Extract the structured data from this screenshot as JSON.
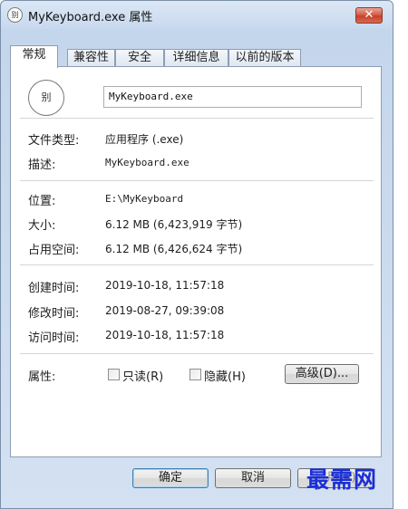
{
  "window": {
    "title": "MyKeyboard.exe 属性",
    "icon_text": "别",
    "close_label": "✕"
  },
  "tabs": [
    {
      "label": "常规",
      "active": true
    },
    {
      "label": "兼容性"
    },
    {
      "label": "安全"
    },
    {
      "label": "详细信息"
    },
    {
      "label": "以前的版本"
    }
  ],
  "general": {
    "file_icon_text": "别",
    "file_name": "MyKeyboard.exe",
    "type_label": "文件类型:",
    "type_value": "应用程序 (.exe)",
    "desc_label": "描述:",
    "desc_value": "MyKeyboard.exe",
    "location_label": "位置:",
    "location_value": "E:\\MyKeyboard",
    "size_label": "大小:",
    "size_value": "6.12 MB (6,423,919 字节)",
    "disk_size_label": "占用空间:",
    "disk_size_value": "6.12 MB (6,426,624 字节)",
    "created_label": "创建时间:",
    "created_value": "2019-10-18, 11:57:18",
    "modified_label": "修改时间:",
    "modified_value": "2019-08-27, 09:39:08",
    "accessed_label": "访问时间:",
    "accessed_value": "2019-10-18, 11:57:18",
    "attributes_label": "属性:",
    "readonly_label": "只读(R)",
    "readonly_checked": false,
    "hidden_label": "隐藏(H)",
    "hidden_checked": false,
    "advanced_label": "高级(D)..."
  },
  "footer": {
    "ok_label": "确定",
    "cancel_label": "取消",
    "apply_label": "应用(A)"
  },
  "watermark": {
    "text": "最需网",
    "color": "#1a2fd6"
  }
}
